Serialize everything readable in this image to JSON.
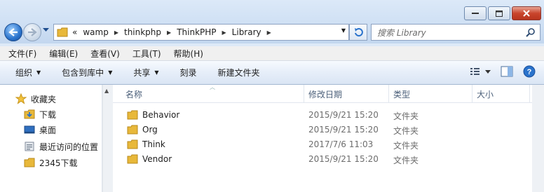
{
  "window": {
    "address_segments": [
      "wamp",
      "thinkphp",
      "ThinkPHP",
      "Library"
    ],
    "address_overflow": "«",
    "search_placeholder": "搜索 Library"
  },
  "menubar": [
    "文件(F)",
    "编辑(E)",
    "查看(V)",
    "工具(T)",
    "帮助(H)"
  ],
  "toolbar": {
    "organize": "组织",
    "include_library": "包含到库中",
    "share": "共享",
    "burn": "刻录",
    "new_folder": "新建文件夹"
  },
  "nav": {
    "items": [
      {
        "label": "收藏夹",
        "icon": "star-icon"
      },
      {
        "label": "下载",
        "icon": "download-folder-icon"
      },
      {
        "label": "桌面",
        "icon": "desktop-icon"
      },
      {
        "label": "最近访问的位置",
        "icon": "recent-places-icon"
      },
      {
        "label": "2345下载",
        "icon": "folder-icon"
      }
    ]
  },
  "columns": {
    "name": "名称",
    "date": "修改日期",
    "type": "类型",
    "size": "大小"
  },
  "files": [
    {
      "name": "Behavior",
      "date": "2015/9/21 15:20",
      "type": "文件夹"
    },
    {
      "name": "Org",
      "date": "2015/9/21 15:20",
      "type": "文件夹"
    },
    {
      "name": "Think",
      "date": "2017/7/6 11:03",
      "type": "文件夹"
    },
    {
      "name": "Vendor",
      "date": "2015/9/21 15:20",
      "type": "文件夹"
    }
  ],
  "colors": {
    "accent": "#2a73cc",
    "folder": "#e8b83a"
  }
}
